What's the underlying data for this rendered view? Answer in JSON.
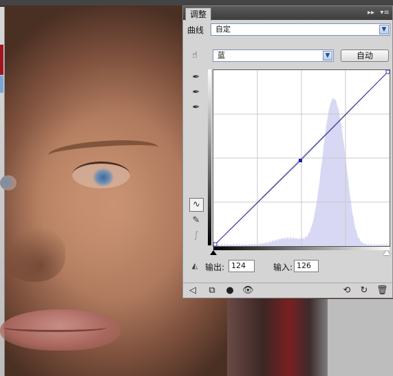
{
  "panel": {
    "tab_title": "调整",
    "menu_icon": "panel-menu-icon",
    "collapse_icon": "collapse-icon"
  },
  "preset": {
    "label": "曲线",
    "value": "自定"
  },
  "channel": {
    "value": "蓝"
  },
  "auto_button": "自动",
  "curve": {
    "channel_color": "#2a2aa6",
    "histogram_color": "#d8d8f4",
    "point_input": 126,
    "point_output": 124
  },
  "readout": {
    "output_label": "输出:",
    "output_value": "124",
    "input_label": "输入:",
    "input_value": "126"
  },
  "tools": [
    "on-image-adjust-icon",
    "black-point-eyedropper-icon",
    "gray-point-eyedropper-icon",
    "white-point-eyedropper-icon",
    "curve-points-icon",
    "pencil-icon",
    "smooth-icon"
  ],
  "bottom_icons": [
    "back-arrow-icon",
    "clip-to-layer-icon",
    "visibility-toggle-icon",
    "eye-icon",
    "view-previous-icon",
    "reset-icon",
    "trash-icon"
  ]
}
